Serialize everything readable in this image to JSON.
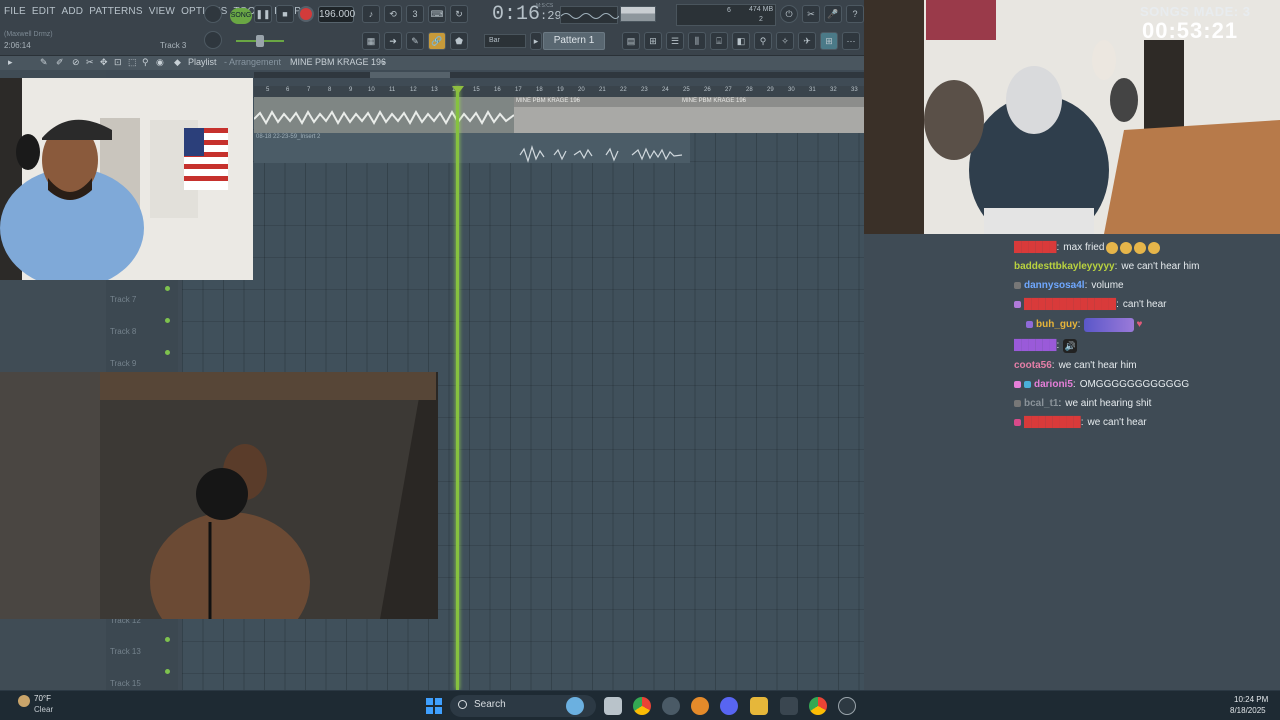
{
  "fl": {
    "menu": [
      "FILE",
      "EDIT",
      "ADD",
      "PATTERNS",
      "VIEW",
      "OPTIONS",
      "TOOLS",
      "HELP"
    ],
    "hint_user": "(Maxwell Drmz)",
    "hint_time": "2:06:14",
    "hint_track": "Track 3",
    "song_mode": "SONG",
    "tempo": "196.000",
    "time_main": "0:16",
    "time_sub": ":29",
    "time_label": "M:S:CS",
    "cpu_mem": "474 MB",
    "cpu_val1": "6",
    "cpu_val2": "2",
    "snap": "Bar",
    "pattern": "Pattern 1"
  },
  "playlist": {
    "title": "Playlist",
    "view": "- Arrangement",
    "pattern": "MINE PBM KRAGE 196",
    "ruler": [
      "5",
      "6",
      "7",
      "8",
      "9",
      "10",
      "11",
      "12",
      "13",
      "14",
      "15",
      "16",
      "17",
      "18",
      "19",
      "20",
      "21",
      "22",
      "23",
      "24",
      "25",
      "26",
      "27",
      "28",
      "29",
      "30",
      "31",
      "32",
      "33"
    ],
    "clip1_labels": [
      "MINE PBM KRAGE 196",
      "MINE PBM KRAGE 196"
    ],
    "clip2_label": "08-18 22-23-59_Insert 2",
    "tracks": [
      {
        "label": "Track 7"
      },
      {
        "label": "Track 8"
      },
      {
        "label": "Track 9"
      },
      {
        "label": "Track 12"
      },
      {
        "label": "Track 13"
      },
      {
        "label": "Track 15"
      }
    ]
  },
  "overlay": {
    "songs_made": "SONGS MADE: 3",
    "timer": "00:53:21"
  },
  "chat": [
    {
      "user": "",
      "color": "#d93a3a",
      "badge": "",
      "message": "max fried",
      "emotes": 4
    },
    {
      "user": "baddesttbkayleyyyyy",
      "color": "#b9d23f",
      "badge": "",
      "message": "we can't hear him"
    },
    {
      "user": "dannysosa4l",
      "color": "#6fa8ff",
      "badge": "#777777",
      "message": "volume"
    },
    {
      "user": "",
      "color": "#d93a3a",
      "badge": "#b07ad9",
      "message": "can't hear"
    },
    {
      "user": "buh_guy",
      "color": "#e7b43a",
      "badge": "#8f6ad9",
      "message": "",
      "wide_emote": true
    },
    {
      "user": "",
      "color": "#9a5ad9",
      "badge": "",
      "message": "",
      "speaker": true
    },
    {
      "user": "coota56",
      "color": "#e67fa8",
      "badge": "",
      "message": "we can't hear him"
    },
    {
      "user": "darioni5",
      "color": "#e67fd9",
      "badge": "#4ab0d9",
      "message": "OMGGGGGGGGGGGG"
    },
    {
      "user": "bcal_t1",
      "color": "#8a939a",
      "badge": "#777777",
      "message": "we aint hearing shit"
    },
    {
      "user": "",
      "color": "#d93a3a",
      "badge": "#d94a8a",
      "message": "we can't hear"
    }
  ],
  "taskbar": {
    "temp": "70°F",
    "condition": "Clear",
    "search": "Search",
    "time": "10:24 PM",
    "date": "8/18/2025"
  }
}
